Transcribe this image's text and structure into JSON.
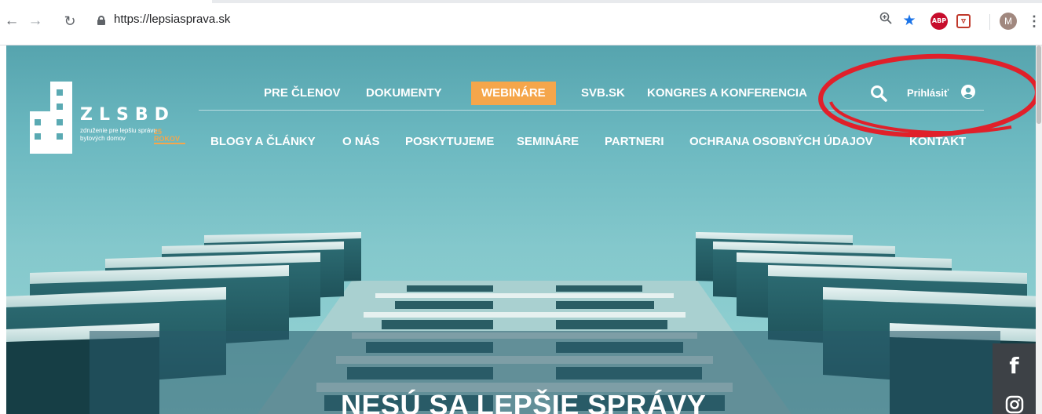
{
  "browser": {
    "url": "https://lepsiasprava.sk",
    "profile_initial": "M",
    "adblock_label": "ABP"
  },
  "site": {
    "logo": {
      "title": "ZLSBD",
      "subtitle": "združenie pre lepšiu správu bytových domov",
      "badge": "25 ROKOV"
    },
    "nav_primary": [
      "PRE ČLENOV",
      "DOKUMENTY",
      "WEBINÁRE",
      "SVB.SK",
      "KONGRES A KONFERENCIA"
    ],
    "nav_primary_active": "WEBINÁRE",
    "nav_secondary": [
      "BLOGY A ČLÁNKY",
      "O NÁS",
      "POSKYTUJEME",
      "SEMINÁRE",
      "PARTNERI",
      "OCHRANA OSOBNÝCH ÚDAJOV",
      "KONTAKT"
    ],
    "login_label": "Prihlásiť",
    "hero_title": "NESÚ SA LEPŠIE SPRÁVY",
    "social": {
      "facebook": "f"
    }
  },
  "colors": {
    "accent_orange": "#f5a64b",
    "annotation_red": "#e0202a",
    "sky": "#6bb8c0"
  }
}
